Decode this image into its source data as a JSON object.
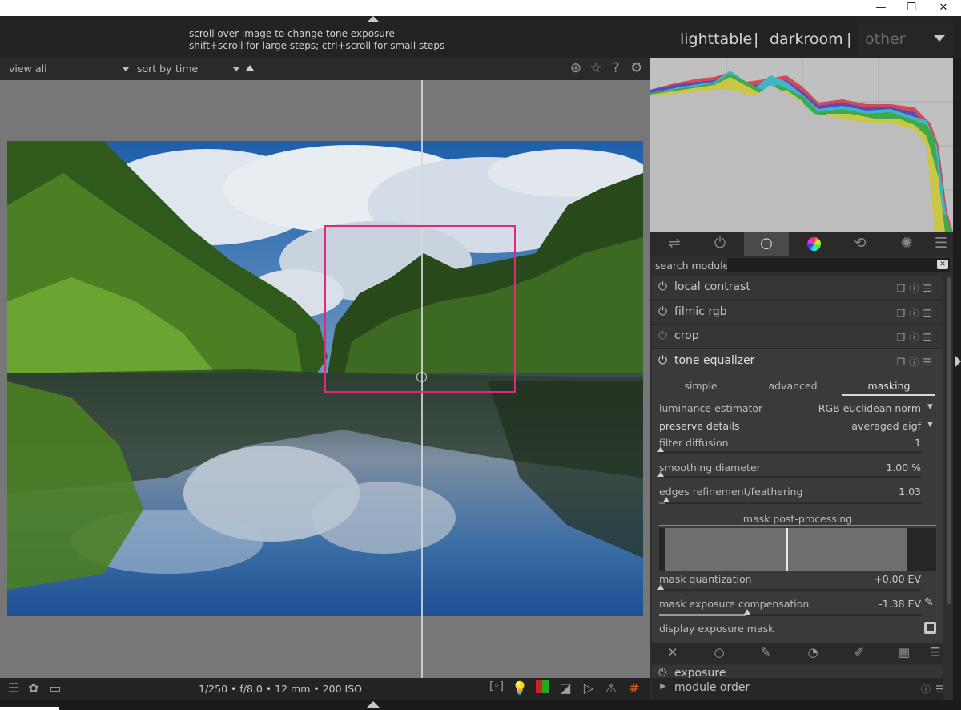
{
  "window": {
    "minimize": "—",
    "maximize": "❐",
    "close": "✕"
  },
  "header": {
    "hint_line1": "scroll over image to change tone exposure",
    "hint_line2": "shift+scroll for large steps; ctrl+scroll for small steps",
    "views": {
      "lighttable": "lighttable",
      "darkroom": "darkroom",
      "other": "other",
      "separator": "|"
    }
  },
  "filterbar": {
    "view_label": "view",
    "view_value": "all",
    "sort_label": "sort by",
    "sort_value": "time"
  },
  "image": {
    "split_marker": "s"
  },
  "bottombar": {
    "exif": "1/250 • f/8.0 • 12 mm • 200 ISO"
  },
  "search": {
    "label": "search module",
    "value": ""
  },
  "modules": {
    "local_contrast": "local contrast",
    "filmic_rgb": "filmic rgb",
    "crop": "crop",
    "tone_equalizer": "tone equalizer",
    "exposure": "exposure",
    "module_order": "module order"
  },
  "tone_equalizer": {
    "tabs": {
      "simple": "simple",
      "advanced": "advanced",
      "masking": "masking"
    },
    "active_tab": "masking",
    "luminance_estimator": {
      "label": "luminance estimator",
      "value": "RGB euclidean norm"
    },
    "preserve_details": {
      "label": "preserve details",
      "value": "averaged eigf"
    },
    "filter_diffusion": {
      "label": "filter diffusion",
      "value": "1",
      "level": 0.0
    },
    "smoothing_diameter": {
      "label": "smoothing diameter",
      "value": "1.00 %",
      "level": 0.0
    },
    "edges_refinement": {
      "label": "edges refinement/feathering",
      "value": "1.03",
      "level": 0.02
    },
    "mask_post_processing": "mask post-processing",
    "mask_quantization": {
      "label": "mask quantization",
      "value": "+0.00 EV",
      "level": 0.0
    },
    "mask_exposure_compensation": {
      "label": "mask exposure compensation",
      "value": "-1.38 EV",
      "level": 0.33
    },
    "display_exposure_mask": {
      "label": "display exposure mask"
    }
  },
  "colors": {
    "accent_box": "#e2287a",
    "panel_bg": "#2f2f2f",
    "center_bg": "#777777"
  }
}
